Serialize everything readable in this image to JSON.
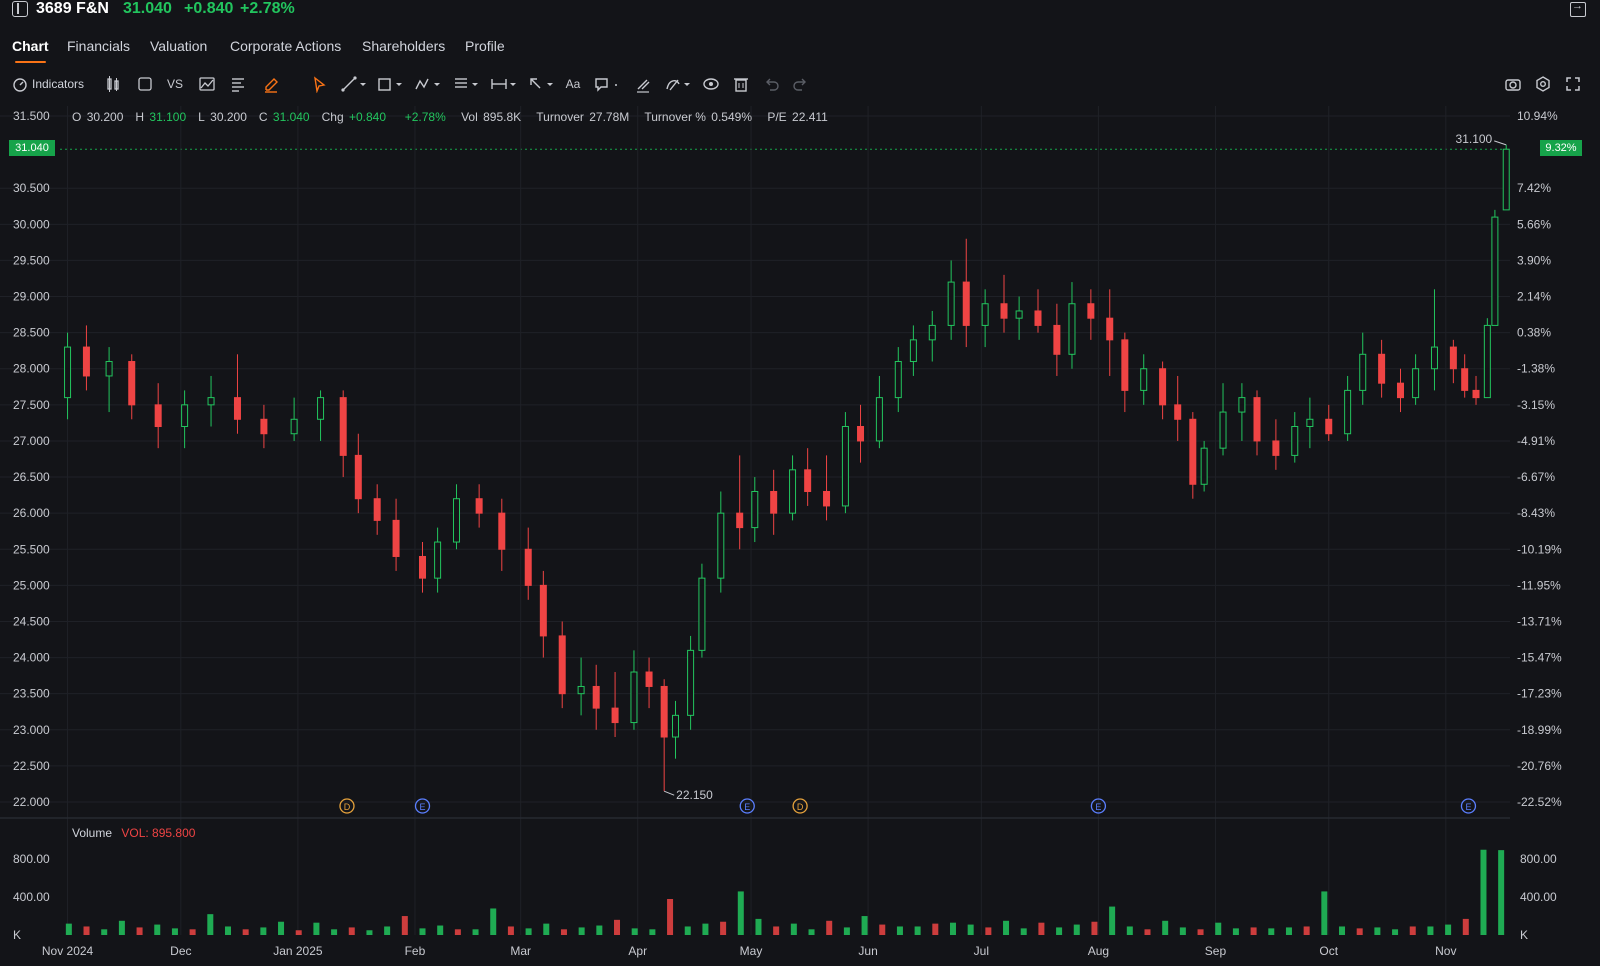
{
  "header": {
    "ticker": "3689 F&N",
    "last_price": "31.040",
    "change": "+0.840",
    "change_pct": "+2.78%"
  },
  "tabs": [
    {
      "label": "Chart",
      "active": true
    },
    {
      "label": "Financials"
    },
    {
      "label": "Valuation"
    },
    {
      "label": "Corporate Actions"
    },
    {
      "label": "Shareholders"
    },
    {
      "label": "Profile"
    }
  ],
  "toolbar": {
    "indicators_label": "Indicators",
    "vs_label": "VS",
    "text_tool_label": "Aa"
  },
  "ohlc_legend": {
    "o_label": "O",
    "o": "30.200",
    "h_label": "H",
    "h": "31.100",
    "l_label": "L",
    "l": "30.200",
    "c_label": "C",
    "c": "31.040",
    "chg_label": "Chg",
    "chg": "+0.840",
    "chg_pct": "+2.78%",
    "vol_label": "Vol",
    "vol": "895.8K",
    "turnover_label": "Turnover",
    "turnover": "27.78M",
    "turnover_pct_label": "Turnover %",
    "turnover_pct": "0.549%",
    "pe_label": "P/E",
    "pe": "22.411"
  },
  "price_tag": "31.040",
  "pct_tag": "9.32%",
  "volume_legend": {
    "label": "Volume",
    "value": "VOL: 895.800"
  },
  "colors": {
    "up": "#22c55e",
    "down": "#ef4444",
    "accent": "#f97316",
    "background": "#131418"
  },
  "chart_data": {
    "type": "candlestick",
    "title": "3689 F&N",
    "price_axis": {
      "ticks": [
        "31.500",
        "31.040",
        "30.500",
        "30.000",
        "29.500",
        "29.000",
        "28.500",
        "28.000",
        "27.500",
        "27.000",
        "26.500",
        "26.000",
        "25.500",
        "25.000",
        "24.500",
        "24.000",
        "23.500",
        "23.000",
        "22.500",
        "22.000"
      ],
      "ylim": [
        22.0,
        31.5
      ]
    },
    "percent_axis": {
      "ticks": [
        "10.94%",
        "9.32%",
        "7.42%",
        "5.66%",
        "3.90%",
        "2.14%",
        "0.38%",
        "-1.38%",
        "-3.15%",
        "-4.91%",
        "-6.67%",
        "-8.43%",
        "-10.19%",
        "-11.95%",
        "-13.71%",
        "-15.47%",
        "-17.23%",
        "-18.99%",
        "-20.76%",
        "-22.52%"
      ]
    },
    "x_labels": [
      "Nov 2024",
      "Dec",
      "Jan 2025",
      "Feb",
      "Mar",
      "Apr",
      "May",
      "Jun",
      "Jul",
      "Aug",
      "Sep",
      "Oct",
      "Nov"
    ],
    "grid": true,
    "annotations": {
      "high_label": "31.100",
      "low_label": "22.150"
    },
    "event_markers": [
      {
        "date": "2025-01-14",
        "type": "D"
      },
      {
        "date": "2025-02-03",
        "type": "E"
      },
      {
        "date": "2025-04-30",
        "type": "E"
      },
      {
        "date": "2025-05-14",
        "type": "D"
      },
      {
        "date": "2025-08-01",
        "type": "E"
      },
      {
        "date": "2025-11-07",
        "type": "E"
      }
    ],
    "candles": [
      {
        "d": "2024-11-01",
        "o": 27.6,
        "h": 28.5,
        "l": 27.3,
        "c": 28.3
      },
      {
        "d": "2024-11-06",
        "o": 28.3,
        "h": 28.6,
        "l": 27.7,
        "c": 27.9
      },
      {
        "d": "2024-11-12",
        "o": 27.9,
        "h": 28.3,
        "l": 27.4,
        "c": 28.1
      },
      {
        "d": "2024-11-18",
        "o": 28.1,
        "h": 28.2,
        "l": 27.3,
        "c": 27.5
      },
      {
        "d": "2024-11-25",
        "o": 27.5,
        "h": 27.8,
        "l": 26.9,
        "c": 27.2
      },
      {
        "d": "2024-12-02",
        "o": 27.2,
        "h": 27.7,
        "l": 26.9,
        "c": 27.5
      },
      {
        "d": "2024-12-09",
        "o": 27.5,
        "h": 27.9,
        "l": 27.2,
        "c": 27.6
      },
      {
        "d": "2024-12-16",
        "o": 27.6,
        "h": 28.2,
        "l": 27.1,
        "c": 27.3
      },
      {
        "d": "2024-12-23",
        "o": 27.3,
        "h": 27.5,
        "l": 26.9,
        "c": 27.1
      },
      {
        "d": "2024-12-31",
        "o": 27.1,
        "h": 27.6,
        "l": 27.0,
        "c": 27.3
      },
      {
        "d": "2025-01-07",
        "o": 27.3,
        "h": 27.7,
        "l": 27.0,
        "c": 27.6
      },
      {
        "d": "2025-01-13",
        "o": 27.6,
        "h": 27.7,
        "l": 26.5,
        "c": 26.8
      },
      {
        "d": "2025-01-17",
        "o": 26.8,
        "h": 27.1,
        "l": 26.0,
        "c": 26.2
      },
      {
        "d": "2025-01-22",
        "o": 26.2,
        "h": 26.4,
        "l": 25.7,
        "c": 25.9
      },
      {
        "d": "2025-01-27",
        "o": 25.9,
        "h": 26.2,
        "l": 25.2,
        "c": 25.4
      },
      {
        "d": "2025-02-03",
        "o": 25.4,
        "h": 25.6,
        "l": 24.9,
        "c": 25.1
      },
      {
        "d": "2025-02-07",
        "o": 25.1,
        "h": 25.8,
        "l": 24.9,
        "c": 25.6
      },
      {
        "d": "2025-02-12",
        "o": 25.6,
        "h": 26.4,
        "l": 25.5,
        "c": 26.2
      },
      {
        "d": "2025-02-18",
        "o": 26.2,
        "h": 26.4,
        "l": 25.8,
        "c": 26.0
      },
      {
        "d": "2025-02-24",
        "o": 26.0,
        "h": 26.2,
        "l": 25.2,
        "c": 25.5
      },
      {
        "d": "2025-03-03",
        "o": 25.5,
        "h": 25.8,
        "l": 24.8,
        "c": 25.0
      },
      {
        "d": "2025-03-07",
        "o": 25.0,
        "h": 25.2,
        "l": 24.0,
        "c": 24.3
      },
      {
        "d": "2025-03-12",
        "o": 24.3,
        "h": 24.5,
        "l": 23.3,
        "c": 23.5
      },
      {
        "d": "2025-03-17",
        "o": 23.5,
        "h": 24.0,
        "l": 23.2,
        "c": 23.6
      },
      {
        "d": "2025-03-21",
        "o": 23.6,
        "h": 23.9,
        "l": 23.0,
        "c": 23.3
      },
      {
        "d": "2025-03-26",
        "o": 23.3,
        "h": 23.8,
        "l": 22.9,
        "c": 23.1
      },
      {
        "d": "2025-03-31",
        "o": 23.1,
        "h": 24.1,
        "l": 23.0,
        "c": 23.8
      },
      {
        "d": "2025-04-04",
        "o": 23.8,
        "h": 24.0,
        "l": 23.3,
        "c": 23.6
      },
      {
        "d": "2025-04-08",
        "o": 23.6,
        "h": 23.7,
        "l": 22.15,
        "c": 22.9
      },
      {
        "d": "2025-04-11",
        "o": 22.9,
        "h": 23.4,
        "l": 22.6,
        "c": 23.2
      },
      {
        "d": "2025-04-15",
        "o": 23.2,
        "h": 24.3,
        "l": 23.0,
        "c": 24.1
      },
      {
        "d": "2025-04-18",
        "o": 24.1,
        "h": 25.3,
        "l": 24.0,
        "c": 25.1
      },
      {
        "d": "2025-04-23",
        "o": 25.1,
        "h": 26.3,
        "l": 24.9,
        "c": 26.0
      },
      {
        "d": "2025-04-28",
        "o": 26.0,
        "h": 26.8,
        "l": 25.5,
        "c": 25.8
      },
      {
        "d": "2025-05-02",
        "o": 25.8,
        "h": 26.5,
        "l": 25.6,
        "c": 26.3
      },
      {
        "d": "2025-05-07",
        "o": 26.3,
        "h": 26.6,
        "l": 25.7,
        "c": 26.0
      },
      {
        "d": "2025-05-12",
        "o": 26.0,
        "h": 26.8,
        "l": 25.9,
        "c": 26.6
      },
      {
        "d": "2025-05-16",
        "o": 26.6,
        "h": 26.9,
        "l": 26.1,
        "c": 26.3
      },
      {
        "d": "2025-05-21",
        "o": 26.3,
        "h": 26.8,
        "l": 25.9,
        "c": 26.1
      },
      {
        "d": "2025-05-26",
        "o": 26.1,
        "h": 27.4,
        "l": 26.0,
        "c": 27.2
      },
      {
        "d": "2025-05-30",
        "o": 27.2,
        "h": 27.5,
        "l": 26.7,
        "c": 27.0
      },
      {
        "d": "2025-06-04",
        "o": 27.0,
        "h": 27.9,
        "l": 26.9,
        "c": 27.6
      },
      {
        "d": "2025-06-09",
        "o": 27.6,
        "h": 28.3,
        "l": 27.4,
        "c": 28.1
      },
      {
        "d": "2025-06-13",
        "o": 28.1,
        "h": 28.6,
        "l": 27.9,
        "c": 28.4
      },
      {
        "d": "2025-06-18",
        "o": 28.4,
        "h": 28.8,
        "l": 28.1,
        "c": 28.6
      },
      {
        "d": "2025-06-23",
        "o": 28.6,
        "h": 29.5,
        "l": 28.4,
        "c": 29.2
      },
      {
        "d": "2025-06-27",
        "o": 29.2,
        "h": 29.8,
        "l": 28.3,
        "c": 28.6
      },
      {
        "d": "2025-07-02",
        "o": 28.6,
        "h": 29.1,
        "l": 28.3,
        "c": 28.9
      },
      {
        "d": "2025-07-07",
        "o": 28.9,
        "h": 29.3,
        "l": 28.5,
        "c": 28.7
      },
      {
        "d": "2025-07-11",
        "o": 28.7,
        "h": 29.0,
        "l": 28.4,
        "c": 28.8
      },
      {
        "d": "2025-07-16",
        "o": 28.8,
        "h": 29.1,
        "l": 28.5,
        "c": 28.6
      },
      {
        "d": "2025-07-21",
        "o": 28.6,
        "h": 28.9,
        "l": 27.9,
        "c": 28.2
      },
      {
        "d": "2025-07-25",
        "o": 28.2,
        "h": 29.2,
        "l": 28.0,
        "c": 28.9
      },
      {
        "d": "2025-07-30",
        "o": 28.9,
        "h": 29.1,
        "l": 28.4,
        "c": 28.7
      },
      {
        "d": "2025-08-04",
        "o": 28.7,
        "h": 29.1,
        "l": 27.9,
        "c": 28.4
      },
      {
        "d": "2025-08-08",
        "o": 28.4,
        "h": 28.5,
        "l": 27.4,
        "c": 27.7
      },
      {
        "d": "2025-08-13",
        "o": 27.7,
        "h": 28.2,
        "l": 27.5,
        "c": 28.0
      },
      {
        "d": "2025-08-18",
        "o": 28.0,
        "h": 28.1,
        "l": 27.3,
        "c": 27.5
      },
      {
        "d": "2025-08-22",
        "o": 27.5,
        "h": 27.9,
        "l": 27.0,
        "c": 27.3
      },
      {
        "d": "2025-08-26",
        "o": 27.3,
        "h": 27.4,
        "l": 26.2,
        "c": 26.4
      },
      {
        "d": "2025-08-29",
        "o": 26.4,
        "h": 27.0,
        "l": 26.3,
        "c": 26.9
      },
      {
        "d": "2025-09-03",
        "o": 26.9,
        "h": 27.8,
        "l": 26.8,
        "c": 27.4
      },
      {
        "d": "2025-09-08",
        "o": 27.4,
        "h": 27.8,
        "l": 27.0,
        "c": 27.6
      },
      {
        "d": "2025-09-12",
        "o": 27.6,
        "h": 27.7,
        "l": 26.8,
        "c": 27.0
      },
      {
        "d": "2025-09-17",
        "o": 27.0,
        "h": 27.3,
        "l": 26.6,
        "c": 26.8
      },
      {
        "d": "2025-09-22",
        "o": 26.8,
        "h": 27.4,
        "l": 26.7,
        "c": 27.2
      },
      {
        "d": "2025-09-26",
        "o": 27.2,
        "h": 27.6,
        "l": 26.9,
        "c": 27.3
      },
      {
        "d": "2025-10-01",
        "o": 27.3,
        "h": 27.5,
        "l": 27.0,
        "c": 27.1
      },
      {
        "d": "2025-10-06",
        "o": 27.1,
        "h": 27.9,
        "l": 27.0,
        "c": 27.7
      },
      {
        "d": "2025-10-10",
        "o": 27.7,
        "h": 28.5,
        "l": 27.5,
        "c": 28.2
      },
      {
        "d": "2025-10-15",
        "o": 28.2,
        "h": 28.4,
        "l": 27.6,
        "c": 27.8
      },
      {
        "d": "2025-10-20",
        "o": 27.8,
        "h": 28.0,
        "l": 27.4,
        "c": 27.6
      },
      {
        "d": "2025-10-24",
        "o": 27.6,
        "h": 28.2,
        "l": 27.5,
        "c": 28.0
      },
      {
        "d": "2025-10-29",
        "o": 28.0,
        "h": 29.1,
        "l": 27.7,
        "c": 28.3
      },
      {
        "d": "2025-11-03",
        "o": 28.3,
        "h": 28.4,
        "l": 27.8,
        "c": 28.0
      },
      {
        "d": "2025-11-06",
        "o": 28.0,
        "h": 28.2,
        "l": 27.6,
        "c": 27.7
      },
      {
        "d": "2025-11-09",
        "o": 27.7,
        "h": 27.9,
        "l": 27.5,
        "c": 27.6
      },
      {
        "d": "2025-11-12",
        "o": 27.6,
        "h": 28.7,
        "l": 27.6,
        "c": 28.6
      },
      {
        "d": "2025-11-14",
        "o": 28.6,
        "h": 30.2,
        "l": 28.6,
        "c": 30.1
      },
      {
        "d": "2025-11-17",
        "o": 30.2,
        "h": 31.1,
        "l": 30.2,
        "c": 31.04
      }
    ],
    "volume": {
      "label": "Volume",
      "ticks": [
        "800.00",
        "400.00",
        "K"
      ],
      "ylim": [
        0,
        950
      ],
      "values": [
        120,
        90,
        60,
        150,
        80,
        110,
        70,
        60,
        220,
        90,
        60,
        80,
        140,
        50,
        130,
        60,
        80,
        50,
        90,
        200,
        70,
        100,
        60,
        60,
        280,
        90,
        70,
        120,
        60,
        80,
        100,
        160,
        70,
        60,
        380,
        90,
        120,
        140,
        460,
        170,
        90,
        120,
        60,
        150,
        80,
        200,
        110,
        90,
        90,
        120,
        130,
        110,
        80,
        150,
        70,
        130,
        80,
        110,
        140,
        300,
        90,
        60,
        150,
        80,
        60,
        130,
        70,
        80,
        70,
        80,
        90,
        460,
        90,
        70,
        80,
        60,
        90,
        90,
        110,
        170,
        900,
        895.8
      ]
    }
  }
}
